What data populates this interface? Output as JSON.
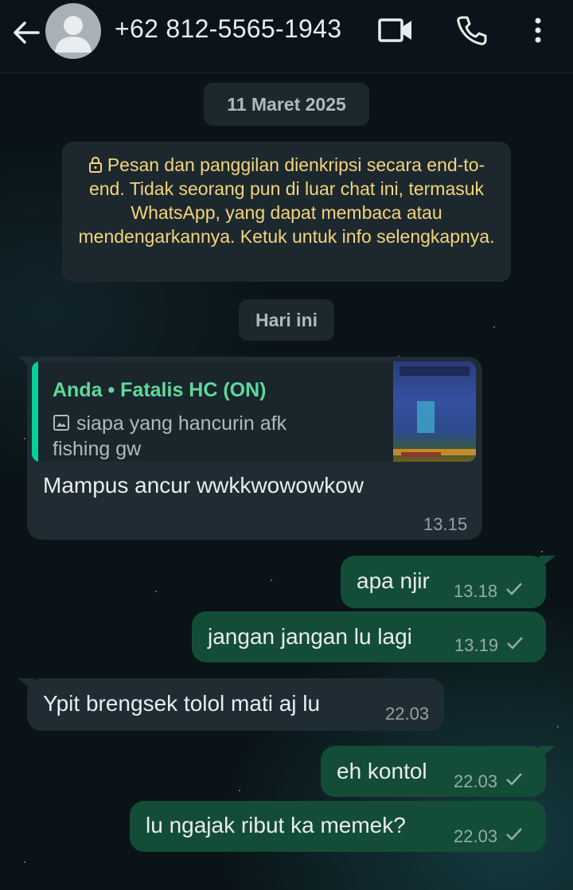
{
  "header": {
    "contact_name": "+62 812-5565-1943"
  },
  "chat": {
    "date_chip": "11 Maret 2025",
    "encryption_notice": "Pesan dan panggilan dienkripsi secara end-to-end. Tidak seorang pun di luar chat ini, termasuk WhatsApp, yang dapat membaca atau mendengarkannya. Ketuk untuk info selengkapnya.",
    "today_chip": "Hari ini",
    "messages": [
      {
        "direction": "in",
        "quote_author": "Anda • Fatalis HC (ON)",
        "quote_text": "siapa yang hancurin afk fishing gw",
        "text": "Mampus ancur wwkkwowowkow",
        "time": "13.15"
      },
      {
        "direction": "out",
        "text": "apa njir",
        "time": "13.18",
        "status": "sent"
      },
      {
        "direction": "out",
        "text": "jangan jangan lu lagi",
        "time": "13.19",
        "status": "sent"
      },
      {
        "direction": "in",
        "text": "Ypit brengsek tolol mati aj lu",
        "time": "22.03"
      },
      {
        "direction": "out",
        "text": "eh kontol",
        "time": "22.03",
        "status": "sent"
      },
      {
        "direction": "out",
        "text": "lu ngajak ribut ka memek?",
        "time": "22.03",
        "status": "sent"
      }
    ]
  },
  "colors": {
    "header_bg": "#0b141a",
    "incoming_bubble": "#1f2c34",
    "outgoing_bubble": "#144d37",
    "quote_accent": "#06cf9c",
    "notice_text": "#f4d47c"
  },
  "icons": [
    "back-arrow-icon",
    "avatar-icon",
    "video-call-icon",
    "phone-icon",
    "more-menu-icon",
    "lock-icon",
    "image-icon",
    "check-icon"
  ]
}
